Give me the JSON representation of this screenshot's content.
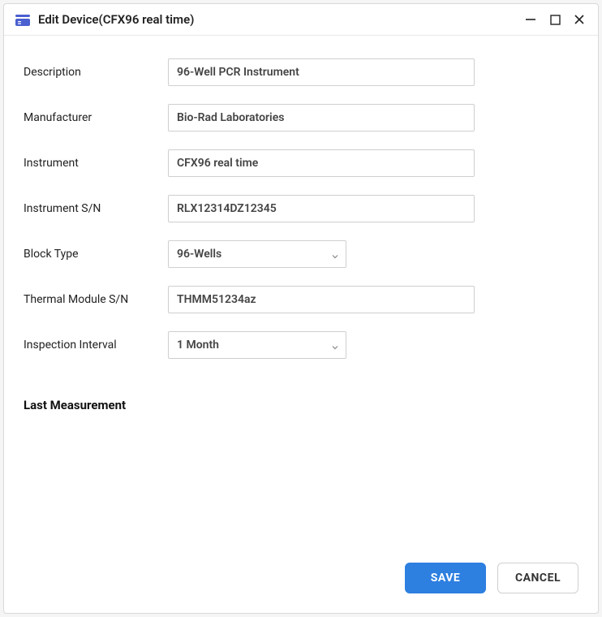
{
  "dialog": {
    "title": "Edit Device(CFX96 real time)"
  },
  "form": {
    "description": {
      "label": "Description",
      "value": "96-Well PCR Instrument"
    },
    "manufacturer": {
      "label": "Manufacturer",
      "value": "Bio-Rad Laboratories"
    },
    "instrument": {
      "label": "Instrument",
      "value": "CFX96 real time"
    },
    "instrument_sn": {
      "label": "Instrument S/N",
      "value": "RLX12314DZ12345"
    },
    "block_type": {
      "label": "Block Type",
      "value": "96-Wells"
    },
    "thermal_module_sn": {
      "label": "Thermal Module S/N",
      "value": "THMM51234az"
    },
    "inspection_interval": {
      "label": "Inspection Interval",
      "value": "1 Month"
    }
  },
  "section": {
    "last_measurement": "Last Measurement"
  },
  "footer": {
    "save": "SAVE",
    "cancel": "CANCEL"
  }
}
